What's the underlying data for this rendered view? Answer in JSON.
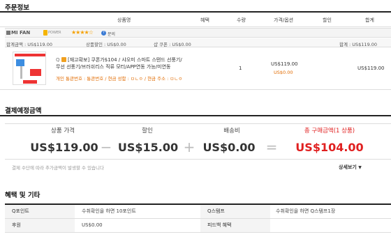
{
  "order_section": {
    "title": "주문정보",
    "columns": [
      "상품명",
      "혜택",
      "수량",
      "가격/옵션",
      "할인",
      "합계"
    ]
  },
  "seller": {
    "name": "MI FAN",
    "power_label": "POWER",
    "stars": "★★★★☆",
    "question_label": "문의"
  },
  "summary_bar": {
    "total_amount": "합계금액 : US$119.00",
    "product_discount": "상품할인 : US$0.00",
    "shop_coupon": "샵 쿠폰 : US$0.00",
    "grand_total": "합계 : US$119.00"
  },
  "product": {
    "title_lead": "Q",
    "title": "[재고확보] 쿠폰가$104 / 샤오미 스마트 스탠드 선풍기/무선 선풍기/브러쉬리스 직류 모터/APP연동 가능/미연동",
    "note": "개인 통관번호 : 통관번호 / 현금 성함 : ㅁㄴㅇ / 현금 주소 : ㅁㄴㅇ",
    "quantity": "1",
    "price": "US$119.00",
    "option_price": "US$0.00",
    "total": "US$119.00"
  },
  "payment_section": {
    "title": "결제예정금액",
    "labels": [
      "상품 가격",
      "할인",
      "배송비",
      "총 구매금액(1 상품)"
    ],
    "values": [
      "US$119.00",
      "US$15.00",
      "US$0.00",
      "US$104.00"
    ],
    "operators": [
      "−",
      "+",
      "="
    ],
    "note": "결제 수단에 따라 추가금액이 발생할 수 있습니다",
    "more_label": "상세보기",
    "more_icon": "chevron-down"
  },
  "benefits_section": {
    "title": "혜택 및 기타",
    "rows": [
      {
        "k1": "Q포인트",
        "v1": "수취확인을 하면 10포인트",
        "k2": "Q스탬프",
        "v2": "수취확인을 하면 Q스탬프1장"
      },
      {
        "k1": "후원",
        "v1": "US$0.00",
        "k2": "피드백 혜택",
        "v2": ""
      }
    ]
  },
  "colors": {
    "accent_red": "#e02020",
    "note_orange": "#e26b00",
    "star": "#f5a000"
  }
}
